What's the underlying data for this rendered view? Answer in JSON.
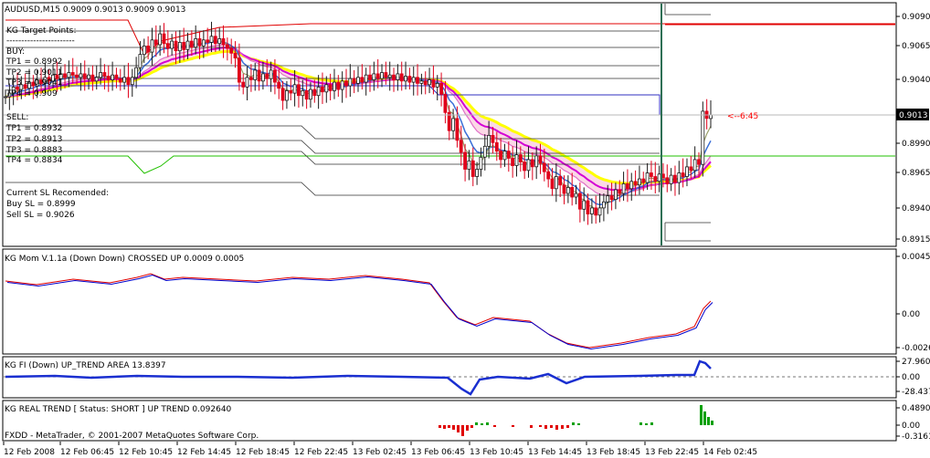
{
  "main": {
    "header": "AUDUSD,M15  0.9009 0.9013 0.9009 0.9013",
    "notes": [
      "KG Target Points:",
      "-----------------------",
      "BUY:",
      "TP1 = 0.8992",
      "TP2 = 0.9011",
      "TP3 = 0.9041",
      "TP4 = 0.909",
      "SELL:",
      "TP1 = 0.8932",
      "TP2 = 0.8913",
      "TP3 = 0.8883",
      "TP4 = 0.8834",
      "Current SL Recomended:",
      "Buy   SL  = 0.8999",
      "Sell   SL  = 0.9026"
    ],
    "price_ticks": [
      "0.9090",
      "0.9065",
      "0.9040",
      "0.9013",
      "0.8990",
      "0.8965",
      "0.8940",
      "0.8915"
    ],
    "current_price": "0.9013",
    "timer": "<--6:45",
    "colors": {
      "bull": "#1a1a1a",
      "bear": "#e0001b",
      "yellow": "#ffff00",
      "magenta": "#d400d4",
      "blue": "#3a6fd8",
      "pink": "#f7a8c8"
    }
  },
  "panels": {
    "mom": {
      "title": "KG Mom V.1.1a   (Down Down)      CROSSED UP      0.0009 0.0005",
      "ticks": [
        "0.0045",
        "0.00",
        "-0.0026"
      ]
    },
    "fi": {
      "title": "KG FI   (Down)    UP_TREND AREA      13.8397",
      "ticks": [
        "27.9609",
        "0.00",
        "-28.4371"
      ]
    },
    "rt": {
      "title": "KG REAL TREND [ Status: SHORT ]    UP TREND      0.092640",
      "ticks": [
        "0.48908",
        "0.00",
        "-0.31613"
      ]
    }
  },
  "footer": "FXDD - MetaTrader, © 2001-2007 MetaQuotes Software Corp.",
  "time_axis": [
    "12 Feb 2008",
    "12 Feb 06:45",
    "12 Feb 10:45",
    "12 Feb 14:45",
    "12 Feb 18:45",
    "12 Feb 22:45",
    "13 Feb 02:45",
    "13 Feb 06:45",
    "13 Feb 10:45",
    "13 Feb 14:45",
    "13 Feb 18:45",
    "13 Feb 22:45",
    "14 Feb 02:45"
  ],
  "chart_data": {
    "type": "candlestick",
    "symbol": "AUDUSD",
    "timeframe": "M15",
    "ylim": [
      0.8905,
      0.9105
    ],
    "close": [
      0.9028,
      0.9031,
      0.9036,
      0.9034,
      0.9038,
      0.9035,
      0.904,
      0.9037,
      0.9042,
      0.9039,
      0.9044,
      0.9041,
      0.9046,
      0.9043,
      0.9047,
      0.9044,
      0.9048,
      0.9046,
      0.9044,
      0.9047,
      0.9043,
      0.9046,
      0.9041,
      0.9044,
      0.9048,
      0.9045,
      0.9042,
      0.9046,
      0.9043,
      0.904,
      0.9044,
      0.9038,
      0.9044,
      0.9052,
      0.9063,
      0.907,
      0.9065,
      0.9075,
      0.9071,
      0.908,
      0.9072,
      0.9068,
      0.9074,
      0.9066,
      0.9073,
      0.9067,
      0.9074,
      0.9069,
      0.9076,
      0.907,
      0.9075,
      0.9073,
      0.9078,
      0.9072,
      0.9076,
      0.9071,
      0.9068,
      0.9064,
      0.906,
      0.904,
      0.9036,
      0.9044,
      0.9042,
      0.905,
      0.9041,
      0.9047,
      0.9043,
      0.905,
      0.904,
      0.9035,
      0.9025,
      0.9033,
      0.9031,
      0.9038,
      0.9029,
      0.9033,
      0.9026,
      0.9034,
      0.9029,
      0.9036,
      0.9032,
      0.9038,
      0.9033,
      0.904,
      0.9034,
      0.9041,
      0.9037,
      0.9043,
      0.9039,
      0.9044,
      0.904,
      0.9046,
      0.9042,
      0.9047,
      0.9043,
      0.9048,
      0.9044,
      0.9046,
      0.9042,
      0.9047,
      0.9041,
      0.9045,
      0.904,
      0.9044,
      0.9039,
      0.9041,
      0.9038,
      0.9042,
      0.9036,
      0.9039,
      0.903,
      0.9015,
      0.9,
      0.901,
      0.8992,
      0.8982,
      0.8968,
      0.8975,
      0.8962,
      0.8968,
      0.8978,
      0.8987,
      0.8996,
      0.899,
      0.8983,
      0.8976,
      0.8983,
      0.8977,
      0.8971,
      0.898,
      0.8974,
      0.8967,
      0.8976,
      0.897,
      0.8979,
      0.8973,
      0.8966,
      0.896,
      0.8952,
      0.8962,
      0.8955,
      0.8948,
      0.8953,
      0.8945,
      0.8948,
      0.8935,
      0.8942,
      0.8931,
      0.8936,
      0.893,
      0.8936,
      0.8941,
      0.8946,
      0.8943,
      0.8951,
      0.8948,
      0.8956,
      0.8952,
      0.8958,
      0.8955,
      0.896,
      0.8957,
      0.8965,
      0.8962,
      0.8958,
      0.8964,
      0.8961,
      0.8956,
      0.8963,
      0.8957,
      0.8965,
      0.8962,
      0.897,
      0.8967,
      0.8976,
      0.8972,
      0.9016,
      0.901,
      0.9013
    ]
  }
}
